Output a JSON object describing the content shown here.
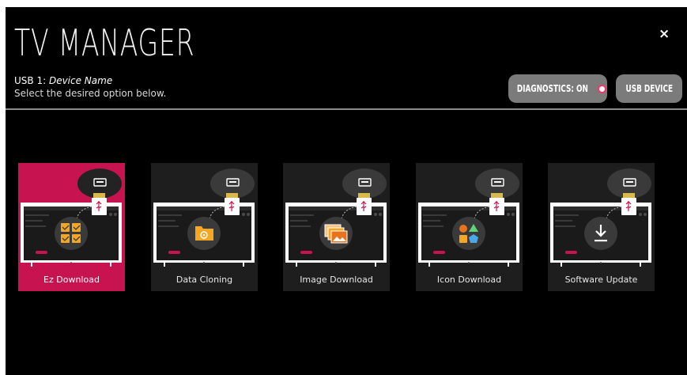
{
  "header": {
    "title": "TV MANAGER",
    "usb_prefix": "USB 1: ",
    "device_name": "Device Name",
    "instruction": "Select the desired option below.",
    "close_label": "×"
  },
  "buttons": {
    "diagnostics_label": "DIAGNOSTICS: ON",
    "usb_device_label": "USB DEVICE"
  },
  "options": [
    {
      "label": "Ez Download",
      "icon": "checklist-icon",
      "selected": true
    },
    {
      "label": "Data Cloning",
      "icon": "folder-gear-icon",
      "selected": false
    },
    {
      "label": "Image Download",
      "icon": "images-icon",
      "selected": false
    },
    {
      "label": "Icon Download",
      "icon": "shapes-icon",
      "selected": false
    },
    {
      "label": "Software Update",
      "icon": "download-icon",
      "selected": false
    }
  ],
  "colors": {
    "accent": "#c7134f",
    "card": "#1e1e1e",
    "icon_orange": "#f5a623",
    "status_dot": "#ff2f6e"
  }
}
